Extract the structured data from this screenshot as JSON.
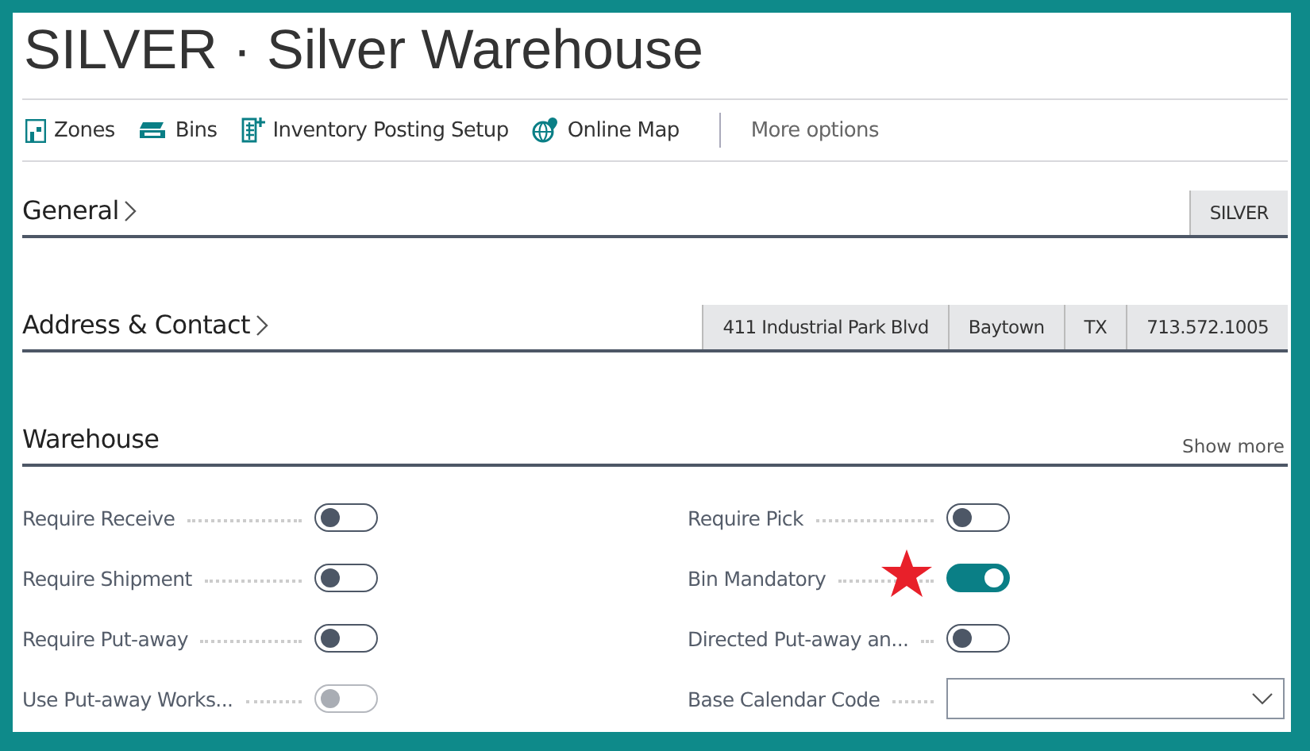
{
  "title": "SILVER · Silver Warehouse",
  "actions": [
    {
      "label": "Zones"
    },
    {
      "label": "Bins"
    },
    {
      "label": "Inventory Posting Setup"
    },
    {
      "label": "Online Map"
    }
  ],
  "more_options": "More options",
  "sections": [
    {
      "title": "General",
      "chevron": true,
      "summary": [
        "SILVER"
      ]
    },
    {
      "title": "Address & Contact",
      "chevron": true,
      "summary": [
        "411 Industrial Park Blvd",
        "Baytown",
        "TX",
        "713.572.1005"
      ]
    },
    {
      "title": "Warehouse",
      "chevron": false,
      "show_more": "Show more"
    }
  ],
  "fields": [
    {
      "label": "Require Receive",
      "kind": "toggle",
      "on": false,
      "disabled": false
    },
    {
      "label": "Require Pick",
      "kind": "toggle",
      "on": false,
      "disabled": false
    },
    {
      "label": "Require Shipment",
      "kind": "toggle",
      "on": false,
      "disabled": false
    },
    {
      "label": "Bin Mandatory",
      "kind": "toggle",
      "on": true,
      "disabled": false,
      "starred": true
    },
    {
      "label": "Require Put-away",
      "kind": "toggle",
      "on": false,
      "disabled": false
    },
    {
      "label": "Directed Put-away an...",
      "kind": "toggle",
      "on": false,
      "disabled": false
    },
    {
      "label": "Use Put-away Works...",
      "kind": "toggle",
      "on": false,
      "disabled": true
    },
    {
      "label": "Base Calendar Code",
      "kind": "dropdown"
    }
  ]
}
